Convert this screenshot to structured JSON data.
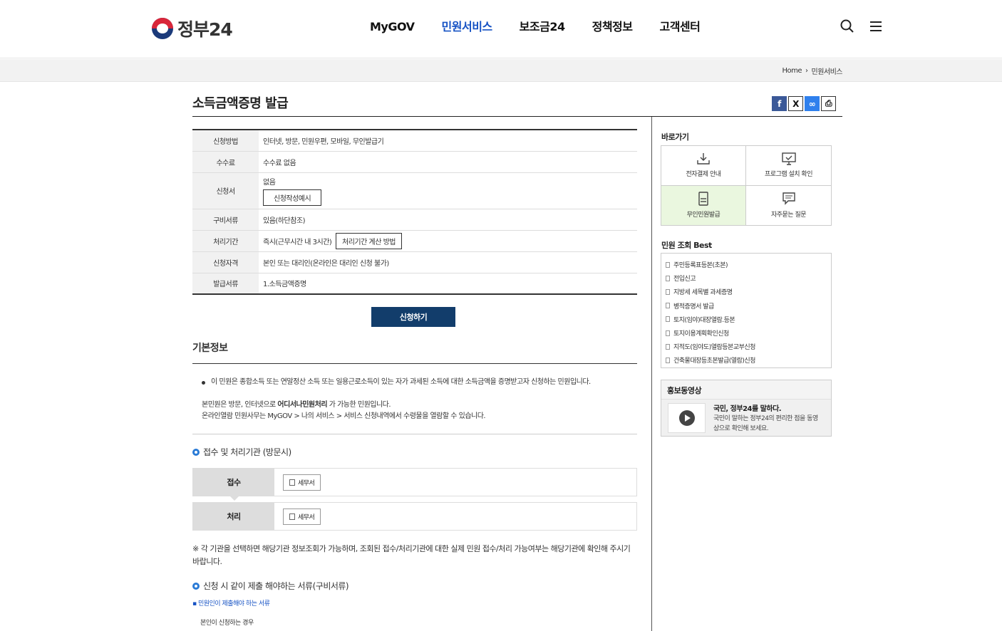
{
  "header": {
    "logo_text": "정부24",
    "menu": [
      "MyGOV",
      "민원서비스",
      "보조금24",
      "정책정보",
      "고객센터"
    ],
    "active_menu": "민원서비스"
  },
  "breadcrumb": {
    "home": "Home",
    "current": "민원서비스"
  },
  "page": {
    "title": "소득금액증명 발급"
  },
  "info_table": {
    "method_label": "신청방법",
    "method_value": "인터넷, 방문, 민원우편, 모바일, 무인발급기",
    "fee_label": "수수료",
    "fee_value": "수수료 없음",
    "form_label": "신청서",
    "form_value": "없음",
    "form_button": "신청작성예시",
    "docs_label": "구비서류",
    "docs_value": "있음(하단참조)",
    "period_label": "처리기간",
    "period_value": "즉시(근무시간 내 3시간)",
    "period_button": "처리기간 계산 방법",
    "qual_label": "신청자격",
    "qual_value": "본인 또는 대리인(온라인은 대리인 신청 불가)",
    "issue_label": "발급서류",
    "issue_value": "1.소득금액증명"
  },
  "apply_button": "신청하기",
  "basic_info": {
    "heading": "기본정보",
    "bullet": "이 민원은 종합소득 또는 연말정산 소득 또는 일용근로소득이 있는 자가 과세된 소득에 대한 소득금액을 증명받고자 신청하는 민원입니다.",
    "line1_pre": "본민원은 방문, 인터넷으로 ",
    "line1_bold": "어디서나민원처리",
    "line1_post": " 가 가능한 민원입니다.",
    "line2": "온라인열람 민원사무는 MyGOV > 나의 서비스 > 서비스 신청내역에서 수령물을 열람할 수 있습니다."
  },
  "orgs": {
    "heading": "접수 및 처리기관 (방문시)",
    "receive_label": "접수",
    "receive_value": "세무서",
    "process_label": "처리",
    "process_value": "세무서",
    "note": "※ 각 기관을 선택하면 해당기관 정보조회가 가능하며, 조회된 접수/처리기관에 대한 실제 민원 접수/처리 가능여부는 해당기관에 확인해 주시기 바랍니다."
  },
  "required_docs": {
    "heading": "신청 시 같이 제출 해야하는 서류(구비서류)",
    "link": "▪ 민원인이 제출해야 하는 서류",
    "sub": "본인이 신청하는 경우"
  },
  "side": {
    "quick_heading": "바로가기",
    "quick": [
      "전자결제 안내",
      "프로그램 설치 확인",
      "무인민원발급",
      "자주묻는 질문"
    ],
    "best_heading": "민원 조회 Best",
    "best": [
      "주민등록표등본(초본)",
      "전입신고",
      "지방세 세목별 과세증명",
      "병적증명서 발급",
      "토지(임야)대장열람.등본",
      "토지이용계획확인신청",
      "지적도(임야도)열람등본교부신청",
      "건축물대장등초본발급(열람)신청"
    ],
    "promo_heading": "홍보동영상",
    "promo_title": "국민, 정부24를 말하다.",
    "promo_text": "국민이 말하는 정부24의 편리한 점을 동영상으로 확인해 보세요."
  },
  "colors": {
    "accent": "#1753c4",
    "apply_bg": "#123d6b",
    "quick_highlight": "#eaf7df"
  }
}
